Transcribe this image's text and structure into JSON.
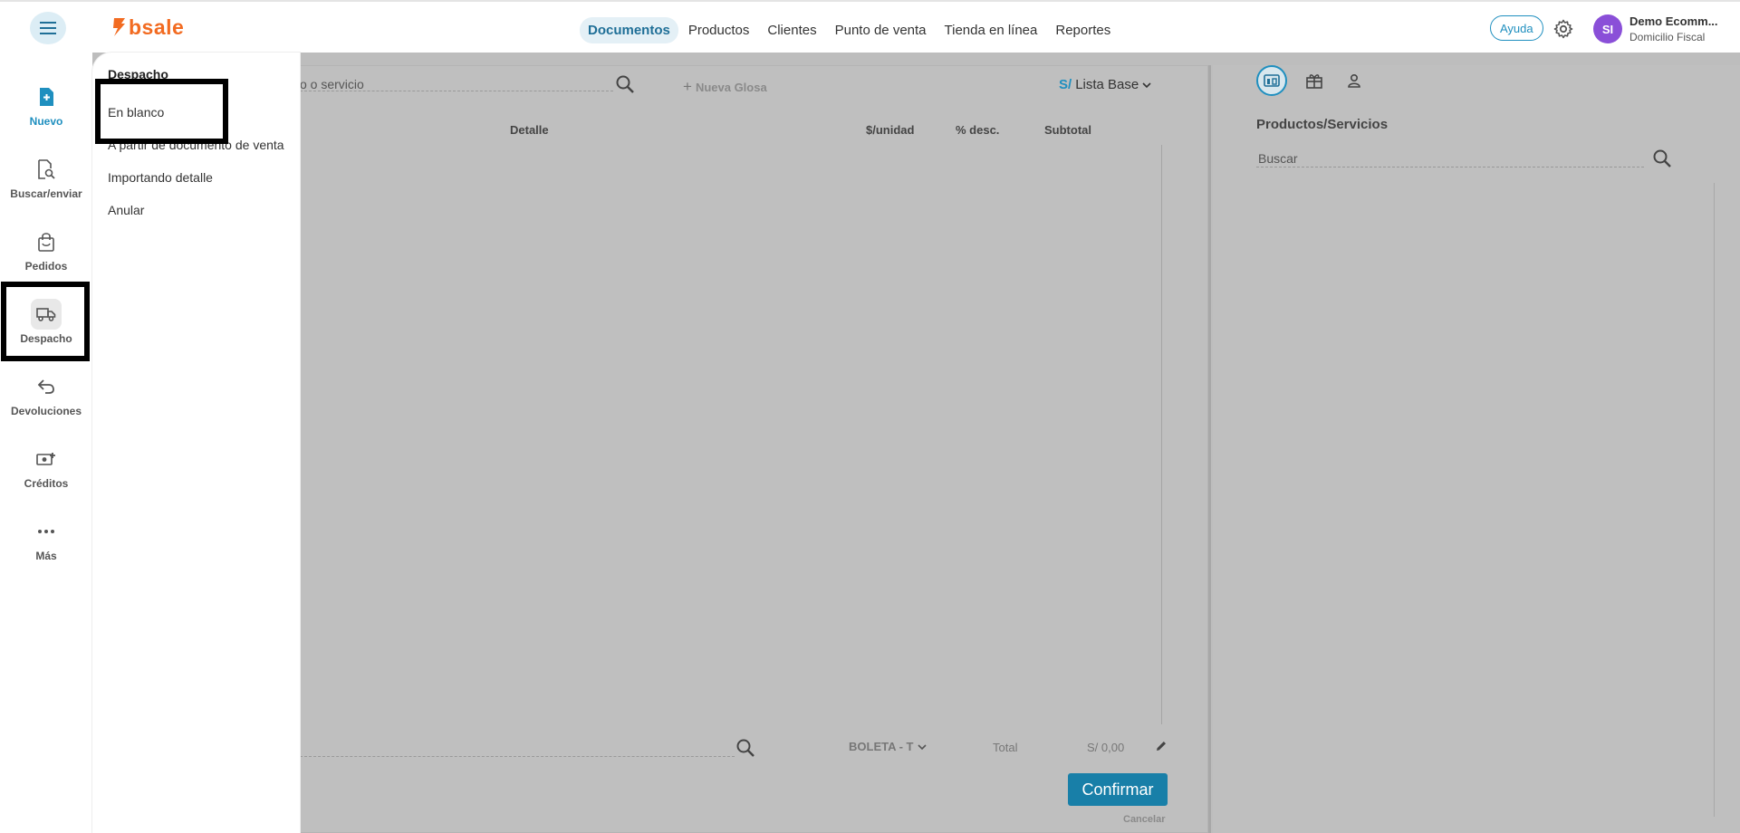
{
  "brand": {
    "logo_text": "bsale",
    "accent": "#f26b21"
  },
  "topnav": {
    "items": [
      {
        "label": "Documentos",
        "active": true
      },
      {
        "label": "Productos"
      },
      {
        "label": "Clientes"
      },
      {
        "label": "Punto de venta"
      },
      {
        "label": "Tienda en línea"
      },
      {
        "label": "Reportes"
      }
    ]
  },
  "header": {
    "help_label": "Ayuda",
    "avatar_initials": "SI",
    "user_name": "Demo Ecomm...",
    "user_sub": "Domicilio Fiscal"
  },
  "sidebar": {
    "items": [
      {
        "label": "Nuevo",
        "icon": "new-document-icon",
        "active": true
      },
      {
        "label": "Buscar/enviar",
        "icon": "search-document-icon"
      },
      {
        "label": "Pedidos",
        "icon": "shopping-bag-icon"
      },
      {
        "label": "Despacho",
        "icon": "truck-icon",
        "selected": true
      },
      {
        "label": "Devoluciones",
        "icon": "return-arrow-icon"
      },
      {
        "label": "Créditos",
        "icon": "credit-cash-icon"
      },
      {
        "label": "Más",
        "icon": "more-dots-icon"
      }
    ]
  },
  "popout": {
    "title": "Despacho",
    "items": [
      {
        "label": "En blanco"
      },
      {
        "label": "A partir de documento de venta"
      },
      {
        "label": "Importando detalle"
      },
      {
        "label": "Anular"
      }
    ]
  },
  "document": {
    "search_placeholder": "o o servicio",
    "new_gloss": "Nueva Glosa",
    "currency_symbol": "S/",
    "price_list": "Lista Base",
    "columns": {
      "detalle": "Detalle",
      "unit": "$/unidad",
      "discount": "% desc.",
      "subtotal": "Subtotal"
    },
    "doc_type": "BOLETA - T",
    "total_label": "Total",
    "total_value": "S/ 0,00",
    "confirm_label": "Confirmar",
    "cancel_label": "Cancelar"
  },
  "right_panel": {
    "title": "Productos/Servicios",
    "search_placeholder": "Buscar",
    "tabs": [
      {
        "icon": "catalog-icon",
        "active": true
      },
      {
        "icon": "gift-icon"
      },
      {
        "icon": "person-icon"
      }
    ]
  }
}
